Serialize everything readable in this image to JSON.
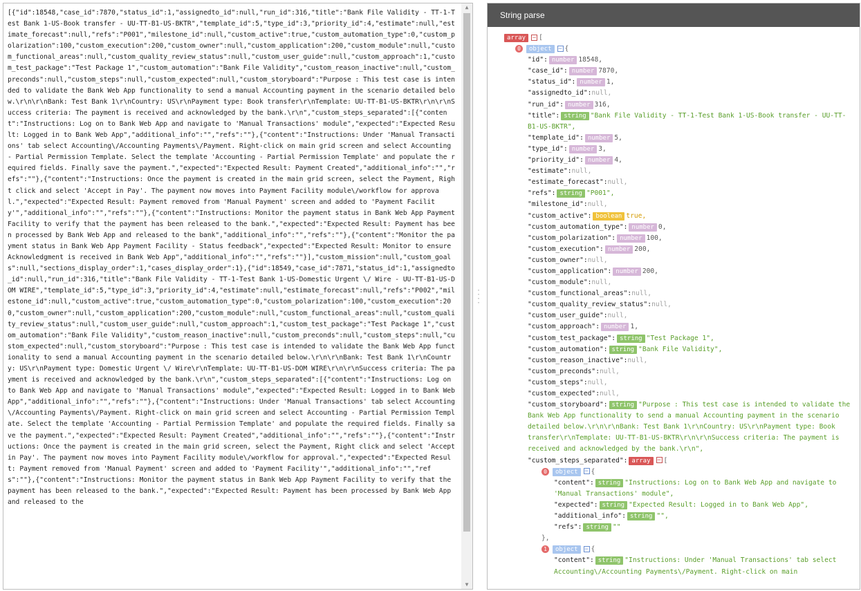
{
  "raw_panel": {
    "text": "[{\"id\":18548,\"case_id\":7870,\"status_id\":1,\"assignedto_id\":null,\"run_id\":316,\"title\":\"Bank File Validity - TT-1-Test Bank 1-US-Book transfer - UU-TT-B1-US-BKTR\",\"template_id\":5,\"type_id\":3,\"priority_id\":4,\"estimate\":null,\"estimate_forecast\":null,\"refs\":\"P001\",\"milestone_id\":null,\"custom_active\":true,\"custom_automation_type\":0,\"custom_polarization\":100,\"custom_execution\":200,\"custom_owner\":null,\"custom_application\":200,\"custom_module\":null,\"custom_functional_areas\":null,\"custom_quality_review_status\":null,\"custom_user_guide\":null,\"custom_approach\":1,\"custom_test_package\":\"Test Package 1\",\"custom_automation\":\"Bank File Validity\",\"custom_reason_inactive\":null,\"custom_preconds\":null,\"custom_steps\":null,\"custom_expected\":null,\"custom_storyboard\":\"Purpose : This test case is intended to validate the Bank Web App functionality to send a manual Accounting payment in the scenario detailed below.\\r\\n\\r\\nBank: Test Bank 1\\r\\nCountry: US\\r\\nPayment type: Book transfer\\r\\nTemplate: UU-TT-B1-US-BKTR\\r\\n\\r\\nSuccess criteria: The payment is received and acknowledged by the bank.\\r\\n\",\"custom_steps_separated\":[{\"content\":\"Instructions: Log on to Bank Web App and navigate to 'Manual Transactions' module\",\"expected\":\"Expected Result: Logged in to Bank Web App\",\"additional_info\":\"\",\"refs\":\"\"},{\"content\":\"Instructions: Under 'Manual Transactions' tab select Accounting\\/Accounting Payments\\/Payment. Right-click on main grid screen and select Accounting - Partial Permission Template. Select the template 'Accounting - Partial Permission Template' and populate the required fields. Finally save the payment.\",\"expected\":\"Expected Result: Payment Created\",\"additional_info\":\"\",\"refs\":\"\"},{\"content\":\"Instructions: Once the payment is created in the main grid screen, select the Payment, Right click and select 'Accept in Pay'. The payment now moves into Payment Facility module\\/workflow for approval.\",\"expected\":\"Expected Result: Payment removed from 'Manual Payment' screen and added to 'Payment Facility'\",\"additional_info\":\"\",\"refs\":\"\"},{\"content\":\"Instructions: Monitor the payment status in Bank Web App Payment Facility to verify that the payment has been released to the bank.\",\"expected\":\"Expected Result: Payment has been processed by Bank Web App and released to the bank\",\"additional_info\":\"\",\"refs\":\"\"},{\"content\":\"Monitor the payment status in Bank Web App Payment Facility - Status feedback\",\"expected\":\"Expected Result: Monitor to ensure Acknowledgment is received in Bank Web App\",\"additional_info\":\"\",\"refs\":\"\"}],\"custom_mission\":null,\"custom_goals\":null,\"sections_display_order\":1,\"cases_display_order\":1},{\"id\":18549,\"case_id\":7871,\"status_id\":1,\"assignedto_id\":null,\"run_id\":316,\"title\":\"Bank File Validity - TT-1-Test Bank 1-US-Domestic Urgent \\/ Wire - UU-TT-B1-US-DOM WIRE\",\"template_id\":5,\"type_id\":3,\"priority_id\":4,\"estimate\":null,\"estimate_forecast\":null,\"refs\":\"P002\",\"milestone_id\":null,\"custom_active\":true,\"custom_automation_type\":0,\"custom_polarization\":100,\"custom_execution\":200,\"custom_owner\":null,\"custom_application\":200,\"custom_module\":null,\"custom_functional_areas\":null,\"custom_quality_review_status\":null,\"custom_user_guide\":null,\"custom_approach\":1,\"custom_test_package\":\"Test Package 1\",\"custom_automation\":\"Bank File Validity\",\"custom_reason_inactive\":null,\"custom_preconds\":null,\"custom_steps\":null,\"custom_expected\":null,\"custom_storyboard\":\"Purpose : This test case is intended to validate the Bank Web App functionality to send a manual Accounting payment in the scenario detailed below.\\r\\n\\r\\nBank: Test Bank 1\\r\\nCountry: US\\r\\nPayment type: Domestic Urgent \\/ Wire\\r\\nTemplate: UU-TT-B1-US-DOM WIRE\\r\\n\\r\\nSuccess criteria: The payment is received and acknowledged by the bank.\\r\\n\",\"custom_steps_separated\":[{\"content\":\"Instructions: Log on to Bank Web App and navigate to 'Manual Transactions' module\",\"expected\":\"Expected Result: Logged in to Bank Web App\",\"additional_info\":\"\",\"refs\":\"\"},{\"content\":\"Instructions: Under 'Manual Transactions' tab select Accounting\\/Accounting Payments\\/Payment. Right-click on main grid screen and select Accounting - Partial Permission Template. Select the template 'Accounting - Partial Permission Template' and populate the required fields. Finally save the payment.\",\"expected\":\"Expected Result: Payment Created\",\"additional_info\":\"\",\"refs\":\"\"},{\"content\":\"Instructions: Once the payment is created in the main grid screen, select the Payment, Right click and select 'Accept in Pay'. The payment now moves into Payment Facility module\\/workflow for approval.\",\"expected\":\"Expected Result: Payment removed from 'Manual Payment' screen and added to 'Payment Facility'\",\"additional_info\":\"\",\"refs\":\"\"},{\"content\":\"Instructions: Monitor the payment status in Bank Web App Payment Facility to verify that the payment has been released to the bank.\",\"expected\":\"Expected Result: Payment has been processed by Bank Web App and released to the"
  },
  "parse_panel": {
    "title": "String parse",
    "root_type": "array",
    "root_bracket": "[",
    "item0_index": "0",
    "item0_type": "object",
    "item0_bracket": "{",
    "fields": [
      {
        "key": "\"id\":",
        "type": "number",
        "value": "18548,"
      },
      {
        "key": "\"case_id\":",
        "type": "number",
        "value": "7870,"
      },
      {
        "key": "\"status_id\":",
        "type": "number",
        "value": "1,"
      },
      {
        "key": "\"assignedto_id\":",
        "type": "",
        "value": "null,"
      },
      {
        "key": "\"run_id\":",
        "type": "number",
        "value": "316,"
      },
      {
        "key": "\"title\":",
        "type": "string",
        "value": "\"Bank File Validity - TT-1-Test Bank 1-US-Book transfer - UU-TT-B1-US-BKTR\","
      },
      {
        "key": "\"template_id\":",
        "type": "number",
        "value": "5,"
      },
      {
        "key": "\"type_id\":",
        "type": "number",
        "value": "3,"
      },
      {
        "key": "\"priority_id\":",
        "type": "number",
        "value": "4,"
      },
      {
        "key": "\"estimate\":",
        "type": "",
        "value": "null,"
      },
      {
        "key": "\"estimate_forecast\":",
        "type": "",
        "value": "null,"
      },
      {
        "key": "\"refs\":",
        "type": "string",
        "value": "\"P001\","
      },
      {
        "key": "\"milestone_id\":",
        "type": "",
        "value": "null,"
      },
      {
        "key": "\"custom_active\":",
        "type": "boolean",
        "value": "true,"
      },
      {
        "key": "\"custom_automation_type\":",
        "type": "number",
        "value": "0,"
      },
      {
        "key": "\"custom_polarization\":",
        "type": "number",
        "value": "100,"
      },
      {
        "key": "\"custom_execution\":",
        "type": "number",
        "value": "200,"
      },
      {
        "key": "\"custom_owner\":",
        "type": "",
        "value": "null,"
      },
      {
        "key": "\"custom_application\":",
        "type": "number",
        "value": "200,"
      },
      {
        "key": "\"custom_module\":",
        "type": "",
        "value": "null,"
      },
      {
        "key": "\"custom_functional_areas\":",
        "type": "",
        "value": "null,"
      },
      {
        "key": "\"custom_quality_review_status\":",
        "type": "",
        "value": "null,"
      },
      {
        "key": "\"custom_user_guide\":",
        "type": "",
        "value": "null,"
      },
      {
        "key": "\"custom_approach\":",
        "type": "number",
        "value": "1,"
      },
      {
        "key": "\"custom_test_package\":",
        "type": "string",
        "value": "\"Test Package 1\","
      },
      {
        "key": "\"custom_automation\":",
        "type": "string",
        "value": "\"Bank File Validity\","
      },
      {
        "key": "\"custom_reason_inactive\":",
        "type": "",
        "value": "null,"
      },
      {
        "key": "\"custom_preconds\":",
        "type": "",
        "value": "null,"
      },
      {
        "key": "\"custom_steps\":",
        "type": "",
        "value": "null,"
      },
      {
        "key": "\"custom_expected\":",
        "type": "",
        "value": "null,"
      },
      {
        "key": "\"custom_storyboard\":",
        "type": "string",
        "value": "\"Purpose : This test case is intended to validate the Bank Web App functionality to send a manual Accounting payment in the scenario detailed below.\\r\\n\\r\\nBank: Test Bank 1\\r\\nCountry: US\\r\\nPayment type: Book transfer\\r\\nTemplate: UU-TT-B1-US-BKTR\\r\\n\\r\\nSuccess criteria: The payment is received and acknowledged by the bank.\\r\\n\","
      }
    ],
    "steps": {
      "key": "\"custom_steps_separated\":",
      "type": "array",
      "bracket": "[",
      "items": [
        {
          "index": "0",
          "type": "object",
          "bracket": "{",
          "fields": [
            {
              "key": "\"content\":",
              "type": "string",
              "value": "\"Instructions: Log on to Bank Web App and navigate to 'Manual Transactions' module\","
            },
            {
              "key": "\"expected\":",
              "type": "string",
              "value": "\"Expected Result: Logged in to Bank Web App\","
            },
            {
              "key": "\"additional_info\":",
              "type": "string",
              "value": "\"\","
            },
            {
              "key": "\"refs\":",
              "type": "string",
              "value": "\"\""
            }
          ],
          "close": "},"
        },
        {
          "index": "1",
          "type": "object",
          "bracket": "{",
          "fields": [
            {
              "key": "\"content\":",
              "type": "string",
              "value": "\"Instructions: Under 'Manual Transactions' tab select Accounting\\/Accounting Payments\\/Payment. Right-click on main"
            }
          ]
        }
      ]
    },
    "toggle_symbol": "−"
  }
}
